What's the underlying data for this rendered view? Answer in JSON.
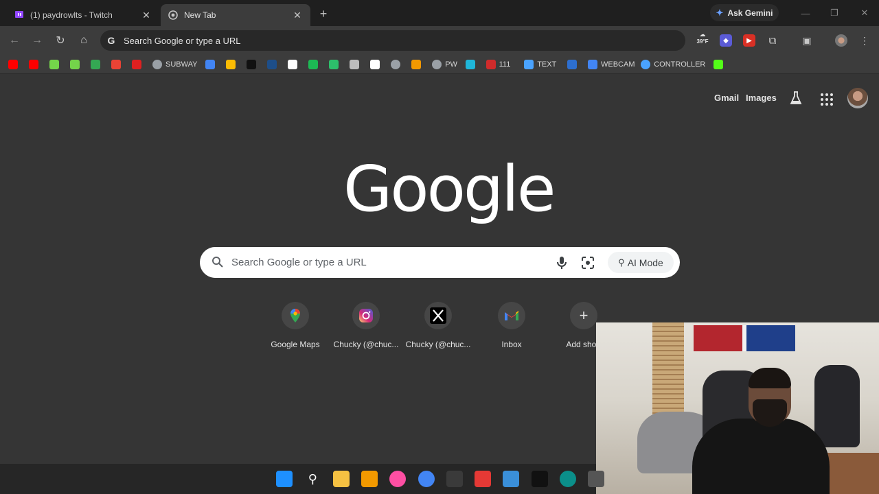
{
  "browser": {
    "tabs": [
      {
        "title": "(1) paydrowlts - Twitch",
        "icon": "twitch-icon",
        "active": false
      },
      {
        "title": "New Tab",
        "icon": "chrome-icon",
        "active": true
      }
    ],
    "gemini_label": "Ask Gemini",
    "omnibox_text": "Search Google or type a URL",
    "weather_badge": "39°F"
  },
  "bookmarks": [
    {
      "label": "",
      "icon": "youtube-icon",
      "color": "#ff0000"
    },
    {
      "label": "",
      "icon": "youtube-icon",
      "color": "#ff0000"
    },
    {
      "label": "",
      "icon": "rumble-icon",
      "color": "#74d44a"
    },
    {
      "label": "",
      "icon": "rumble-icon",
      "color": "#74d44a"
    },
    {
      "label": "",
      "icon": "maps-icon",
      "color": "#34a853"
    },
    {
      "label": "",
      "icon": "gmail-icon",
      "color": "#ea4335"
    },
    {
      "label": "",
      "icon": "fanatics-icon",
      "color": "#e02020"
    },
    {
      "label": "SUBWAY",
      "icon": "globe-icon",
      "color": "#9aa0a6"
    },
    {
      "label": "",
      "icon": "docs-icon",
      "color": "#4285f4"
    },
    {
      "label": "",
      "icon": "drive-icon",
      "color": "#fbbc04"
    },
    {
      "label": "",
      "icon": "tradingview-icon",
      "color": "#111111"
    },
    {
      "label": "",
      "icon": "x-icon",
      "color": "#1d4e89"
    },
    {
      "label": "",
      "icon": "doc-icon",
      "color": "#ffffff"
    },
    {
      "label": "",
      "icon": "spotify-icon",
      "color": "#1db954"
    },
    {
      "label": "",
      "icon": "w-icon",
      "color": "#2dbf6b"
    },
    {
      "label": "",
      "icon": "window-icon",
      "color": "#bdbdbd"
    },
    {
      "label": "",
      "icon": "github-icon",
      "color": "#ffffff"
    },
    {
      "label": "",
      "icon": "globe-icon",
      "color": "#9aa0a6"
    },
    {
      "label": "",
      "icon": "play-icon",
      "color": "#f29900"
    },
    {
      "label": "PW",
      "icon": "globe-icon",
      "color": "#9aa0a6"
    },
    {
      "label": "",
      "icon": "play-icon",
      "color": "#1fb6d9"
    },
    {
      "label": "111",
      "icon": "111-icon",
      "color": "#d02b2b"
    },
    {
      "label": "TEXT",
      "icon": "t-icon",
      "color": "#4aa3ff"
    },
    {
      "label": "",
      "icon": "h-icon",
      "color": "#2d6fd0"
    },
    {
      "label": "WEBCAM",
      "icon": "dots-icon",
      "color": "#4285f4"
    },
    {
      "label": "CONTROLLER",
      "icon": "refresh-icon",
      "color": "#4aa3ff"
    },
    {
      "label": "",
      "icon": "kick-icon",
      "color": "#53fc18"
    }
  ],
  "top_links": {
    "gmail": "Gmail",
    "images": "Images"
  },
  "logo_text": "Google",
  "search": {
    "placeholder": "Search Google or type a URL",
    "ai_mode": "AI Mode"
  },
  "shortcuts": [
    {
      "label": "Google Maps",
      "icon": "maps-pin-icon"
    },
    {
      "label": "Chucky (@chuc...",
      "icon": "instagram-icon"
    },
    {
      "label": "Chucky (@chuc...",
      "icon": "x-logo-icon"
    },
    {
      "label": "Inbox",
      "icon": "gmail-icon"
    },
    {
      "label": "Add short",
      "icon": "plus-icon"
    }
  ],
  "taskbar": [
    {
      "icon": "windows-start-icon",
      "color": "#1e90ff"
    },
    {
      "icon": "search-icon",
      "color": "#262626"
    },
    {
      "icon": "file-explorer-icon",
      "color": "#f5c142"
    },
    {
      "icon": "fl-studio-icon",
      "color": "#f29900"
    },
    {
      "icon": "itunes-icon",
      "color": "#ff4fa3"
    },
    {
      "icon": "chrome-icon",
      "color": "#4285f4"
    },
    {
      "icon": "davinci-icon",
      "color": "#3a3a3a"
    },
    {
      "icon": "speed-icon",
      "color": "#e53935"
    },
    {
      "icon": "photos-icon",
      "color": "#3a8fd9"
    },
    {
      "icon": "skate-icon",
      "color": "#111111"
    },
    {
      "icon": "obs-icon",
      "color": "#0b8f8a"
    },
    {
      "icon": "clock-icon",
      "color": "#555555"
    }
  ]
}
